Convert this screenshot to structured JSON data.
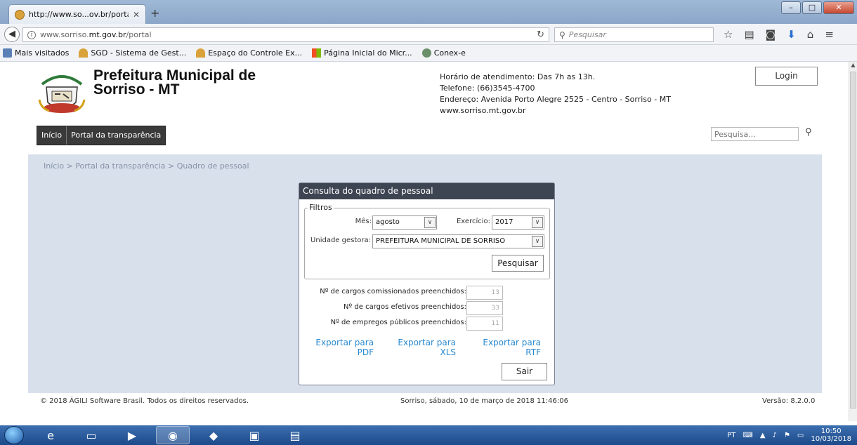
{
  "browser": {
    "tab_title": "http://www.so...ov.br/portal",
    "url_prefix": "www.sorriso.",
    "url_host": "mt.gov.br",
    "url_path": "/portal",
    "search_placeholder": "Pesquisar",
    "bookmarks": [
      {
        "label": "Mais visitados",
        "icon": "bookmark-folder-icon"
      },
      {
        "label": "SGD - Sistema de Gest...",
        "icon": "site-icon"
      },
      {
        "label": "Espaço do Controle Ex...",
        "icon": "site-icon"
      },
      {
        "label": "Página Inicial do Micr...",
        "icon": "microsoft-icon"
      },
      {
        "label": "Conex-e",
        "icon": "globe-icon"
      }
    ]
  },
  "site": {
    "title_line1": "Prefeitura Municipal de",
    "title_line2": "Sorriso - MT",
    "hours": "Horário de atendimento: Das 7h as 13h.",
    "phone": "Telefone: (66)3545-4700",
    "address": "Endereço: Avenida Porto Alegre 2525 - Centro - Sorriso - MT",
    "website": "www.sorriso.mt.gov.br",
    "login_label": "Login",
    "nav": [
      "Início",
      "Portal da transparência"
    ],
    "search_placeholder": "Pesquisa...",
    "breadcrumb": "Início > Portal da transparência > Quadro de pessoal"
  },
  "dialog": {
    "title": "Consulta do quadro de pessoal",
    "filters_legend": "Filtros",
    "month_label": "Mês:",
    "month_value": "agosto",
    "year_label": "Exercício:",
    "year_value": "2017",
    "unit_label": "Unidade gestora:",
    "unit_value": "PREFEITURA MUNICIPAL DE SORRISO",
    "search_button": "Pesquisar",
    "counts": [
      {
        "label": "Nº de cargos comissionados preenchidos:",
        "value": "13"
      },
      {
        "label": "Nº de cargos efetivos preenchidos:",
        "value": "33"
      },
      {
        "label": "Nº de empregos públicos preenchidos:",
        "value": "11"
      }
    ],
    "export_pdf": [
      "Exportar para",
      "PDF"
    ],
    "export_xls": [
      "Exportar para",
      "XLS"
    ],
    "export_rtf": [
      "Exportar para",
      "RTF"
    ],
    "exit_button": "Sair"
  },
  "footer": {
    "copyright": "© 2018 ÁGILI Software Brasil. Todos os direitos reservados.",
    "date": "Sorriso, sábado, 10 de março de 2018 11:46:06",
    "version": "Versão: 8.2.0.0"
  },
  "taskbar": {
    "lang": "PT",
    "time": "10:50",
    "date": "10/03/2018"
  }
}
